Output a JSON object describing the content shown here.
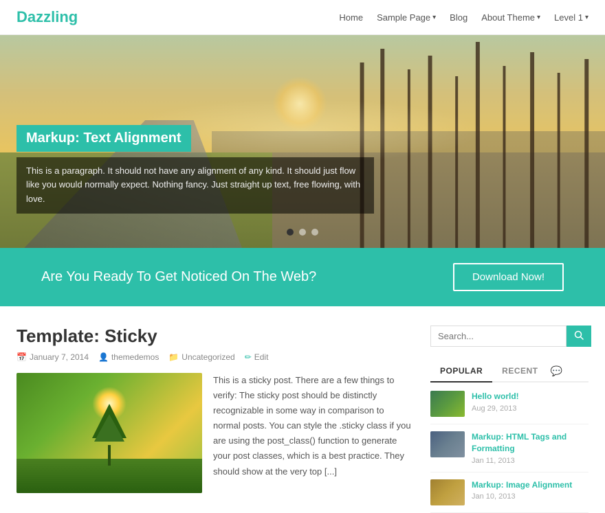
{
  "header": {
    "logo": "Dazzling",
    "nav": [
      {
        "label": "Home",
        "has_dropdown": false
      },
      {
        "label": "Sample Page",
        "has_dropdown": true
      },
      {
        "label": "Blog",
        "has_dropdown": false
      },
      {
        "label": "About Theme",
        "has_dropdown": true
      },
      {
        "label": "Level 1",
        "has_dropdown": true
      }
    ]
  },
  "hero": {
    "title": "Markup: Text Alignment",
    "description": "This is a paragraph. It should not have any alignment of any kind. It should just flow like you would normally expect. Nothing fancy. Just straight up text, free flowing, with love.",
    "dots": [
      {
        "active": true
      },
      {
        "active": false
      },
      {
        "active": false
      }
    ]
  },
  "cta": {
    "text": "Are You Ready To Get Noticed On The Web?",
    "button_label": "Download Now!"
  },
  "post": {
    "title": "Template: Sticky",
    "meta": {
      "date": "January 7, 2014",
      "author": "themedemos",
      "category": "Uncategorized",
      "edit": "Edit"
    },
    "excerpt": "This is a sticky post. There are a few things to verify: The sticky post should be distinctly recognizable in some way in comparison to normal posts. You can style the .sticky class if you are using the post_class() function to generate your post classes, which is a best practice. They should show at the very top [...]"
  },
  "sidebar": {
    "search_placeholder": "Search...",
    "tabs": [
      {
        "label": "POPULAR",
        "active": true
      },
      {
        "label": "RECENT",
        "active": false
      }
    ],
    "popular_posts": [
      {
        "title": "Hello world!",
        "date": "Aug 29, 2013",
        "thumb_class": "sidebar-thumb-1"
      },
      {
        "title": "Markup: HTML Tags and Formatting",
        "date": "Jan 11, 2013",
        "thumb_class": "sidebar-thumb-2"
      },
      {
        "title": "Markup: Image Alignment",
        "date": "Jan 10, 2013",
        "thumb_class": "sidebar-thumb-3"
      }
    ]
  },
  "colors": {
    "accent": "#2dbfa9",
    "text_dark": "#333333",
    "text_light": "#888888"
  }
}
